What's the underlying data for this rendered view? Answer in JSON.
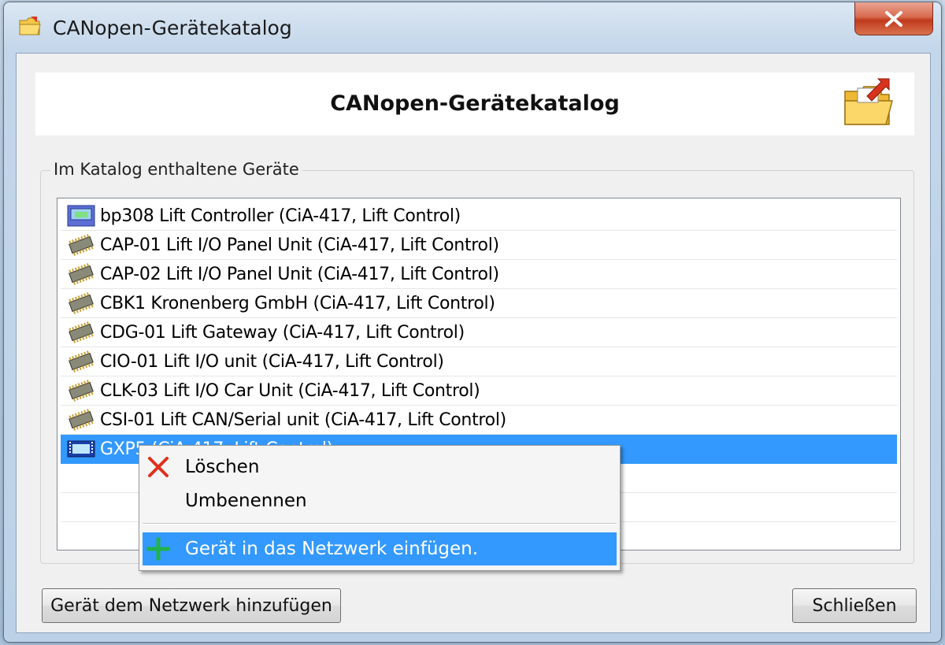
{
  "window": {
    "title": "CANopen-Gerätekatalog",
    "close_glyph": "✕"
  },
  "header": {
    "title": "CANopen-Gerätekatalog",
    "icon": "folder-arrow-icon"
  },
  "catalog": {
    "group_label": "Im Katalog enthaltene Geräte",
    "items": [
      {
        "label": "bp308 Lift Controller (CiA-417, Lift Control)",
        "icon": "controller-icon"
      },
      {
        "label": "CAP-01 Lift I/O Panel Unit (CiA-417, Lift Control)",
        "icon": "chip-icon"
      },
      {
        "label": "CAP-02 Lift I/O Panel Unit (CiA-417, Lift Control)",
        "icon": "chip-icon"
      },
      {
        "label": "CBK1 Kronenberg GmbH (CiA-417, Lift Control)",
        "icon": "chip-icon"
      },
      {
        "label": "CDG-01 Lift Gateway (CiA-417, Lift Control)",
        "icon": "chip-icon"
      },
      {
        "label": "CIO-01 Lift I/O unit (CiA-417, Lift Control)",
        "icon": "chip-icon"
      },
      {
        "label": "CLK-03 Lift I/O Car Unit (CiA-417, Lift Control)",
        "icon": "chip-icon"
      },
      {
        "label": "CSI-01 Lift CAN/Serial unit (CiA-417, Lift Control)",
        "icon": "chip-icon"
      },
      {
        "label": "GXP5 (CiA-417, Lift Control)",
        "icon": "film-icon",
        "selected": true
      }
    ]
  },
  "context_menu": {
    "items": [
      {
        "label": "Löschen",
        "icon": "delete-x-icon"
      },
      {
        "label": "Umbenennen",
        "icon": ""
      },
      {
        "label": "Gerät in das Netzwerk einfügen.",
        "icon": "add-plus-icon",
        "highlighted": true
      }
    ]
  },
  "buttons": {
    "add_to_network": "Gerät dem Netzwerk hinzufügen",
    "close": "Schließen"
  },
  "colors": {
    "selection": "#3399ff",
    "close_button": "#c0391c",
    "delete_icon": "#e0301e",
    "add_icon": "#22b14c"
  }
}
